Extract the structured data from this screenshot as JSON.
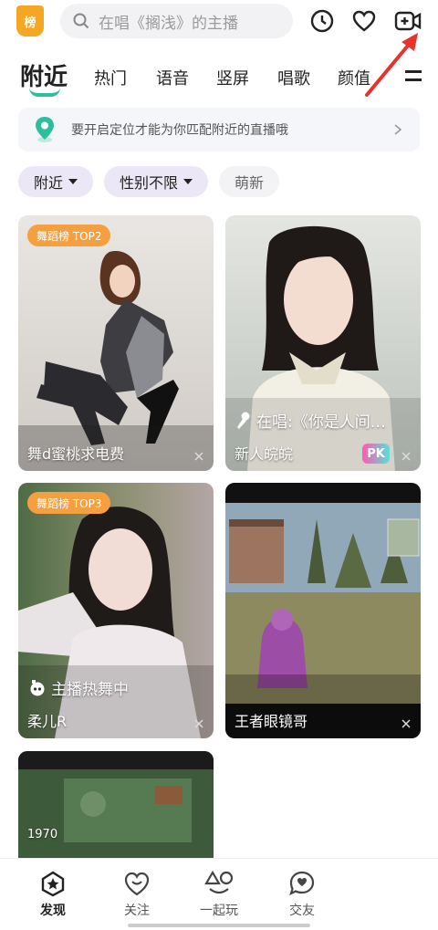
{
  "header": {
    "rank_badge": "榜",
    "search_placeholder": "在唱《搁浅》的主播",
    "icons": [
      "history-icon",
      "heart-icon",
      "start-live-icon"
    ]
  },
  "tabs": [
    {
      "label": "附近",
      "active": true
    },
    {
      "label": "热门"
    },
    {
      "label": "语音"
    },
    {
      "label": "竖屏"
    },
    {
      "label": "唱歌"
    },
    {
      "label": "颜值"
    }
  ],
  "location_banner": {
    "text": "要开启定位才能为你匹配附近的直播哦"
  },
  "filters": [
    {
      "label": "附近",
      "dropdown": true
    },
    {
      "label": "性别不限",
      "dropdown": true
    },
    {
      "label": "萌新",
      "dropdown": false
    }
  ],
  "cards": [
    {
      "badge": "舞蹈榜 TOP2",
      "name": "舞d蜜桃求电费"
    },
    {
      "status": "在唱:《你是人间…",
      "name": "新人皖皖",
      "pk": "PK"
    },
    {
      "badge": "舞蹈榜 TOP3",
      "status": "主播热舞中",
      "name": "柔儿R"
    },
    {
      "name": "王者眼镜哥"
    },
    {
      "game_text": "1970"
    }
  ],
  "bottom_nav": [
    {
      "label": "发现",
      "active": true
    },
    {
      "label": "关注"
    },
    {
      "label": "一起玩"
    },
    {
      "label": "交友"
    }
  ],
  "colors": {
    "accent": "#2bbf9c",
    "badge": "#f5a040",
    "annotation_arrow": "#e8322e"
  }
}
